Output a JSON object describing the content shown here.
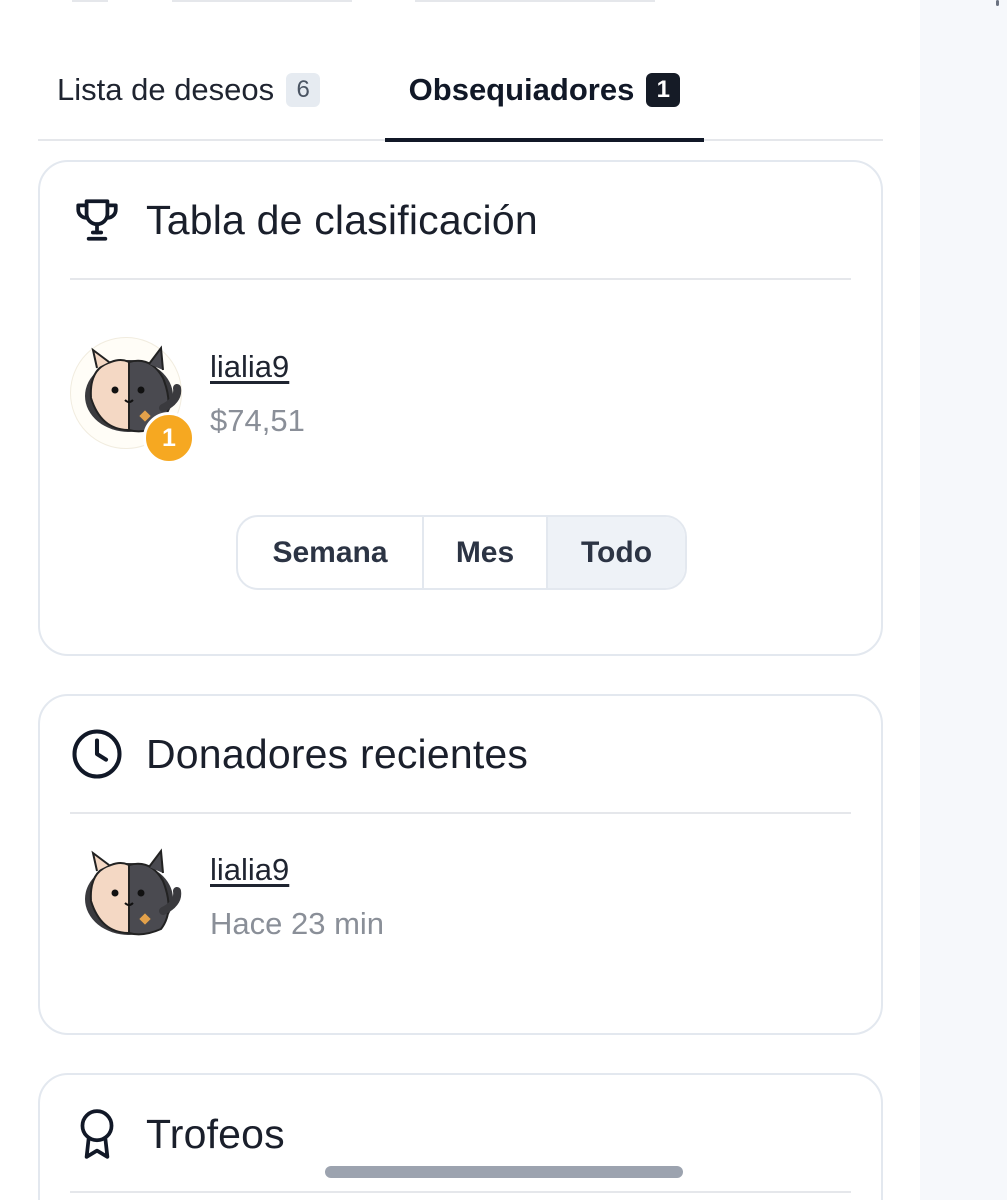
{
  "tabs": [
    {
      "label": "Lista de deseos",
      "count": "6"
    },
    {
      "label": "Obsequiadores",
      "count": "1",
      "active": true
    }
  ],
  "leaderboard": {
    "title": "Tabla de clasificación",
    "icon": "trophy-icon",
    "entries": [
      {
        "rank": "1",
        "username": "lialia9",
        "amount": "$74,51"
      }
    ],
    "periods": [
      "Semana",
      "Mes",
      "Todo"
    ],
    "selected_period": "Todo"
  },
  "recent": {
    "title": "Donadores recientes",
    "icon": "clock-icon",
    "entries": [
      {
        "username": "lialia9",
        "time": "Hace 23 min"
      }
    ]
  },
  "trophies": {
    "title": "Trofeos",
    "icon": "ribbon-award-icon"
  },
  "colors": {
    "rank_gold": "#f6a821",
    "active_badge": "#151b26",
    "card_border": "#e3e8ef",
    "selected_segment": "#eef2f7"
  }
}
